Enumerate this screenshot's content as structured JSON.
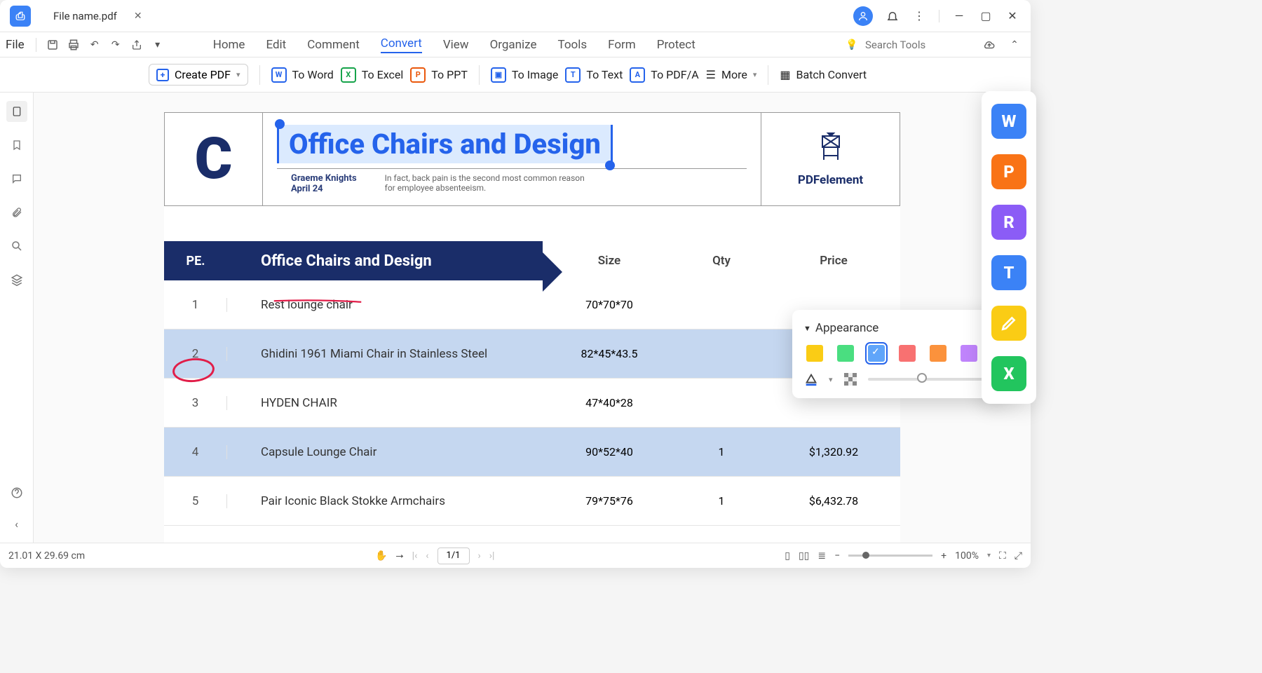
{
  "window": {
    "tab_name": "File name.pdf"
  },
  "menu": {
    "file": "File",
    "tabs": [
      "Home",
      "Edit",
      "Comment",
      "Convert",
      "View",
      "Organize",
      "Tools",
      "Form",
      "Protect"
    ],
    "active_tab": "Convert",
    "search_placeholder": "Search Tools"
  },
  "convert": {
    "create_pdf": "Create PDF",
    "to_word": "To Word",
    "to_excel": "To Excel",
    "to_ppt": "To PPT",
    "to_image": "To Image",
    "to_text": "To Text",
    "to_pdfa": "To PDF/A",
    "more": "More",
    "batch": "Batch Convert"
  },
  "document": {
    "title": "Office Chairs and Design",
    "author": "Graeme Knights",
    "date": "April 24",
    "tagline1": "In fact, back pain is the second most common reason",
    "tagline2": "for employee absenteeism.",
    "brand": "PDFelement",
    "table": {
      "pe_label": "PE.",
      "desc_label": "Office Chairs and Design",
      "headers": {
        "size": "Size",
        "qty": "Qty",
        "price": "Price"
      },
      "rows": [
        {
          "n": "1",
          "name": "Rest lounge chair",
          "size": "70*70*70",
          "qty": "",
          "price": ""
        },
        {
          "n": "2",
          "name": "Ghidini 1961 Miami Chair in Stainless Steel",
          "size": "82*45*43.5",
          "qty": "",
          "price": ""
        },
        {
          "n": "3",
          "name": "HYDEN CHAIR",
          "size": "47*40*28",
          "qty": "",
          "price": ""
        },
        {
          "n": "4",
          "name": "Capsule Lounge Chair",
          "size": "90*52*40",
          "qty": "1",
          "price": "$1,320.92"
        },
        {
          "n": "5",
          "name": "Pair Iconic Black Stokke Armchairs",
          "size": "79*75*76",
          "qty": "1",
          "price": "$6,432.78"
        }
      ]
    }
  },
  "appearance": {
    "title": "Appearance",
    "colors": [
      "#facc15",
      "#4ade80",
      "#60a5fa",
      "#f87171",
      "#fb923c",
      "#c084fc"
    ],
    "selected_index": 2
  },
  "status": {
    "dimensions": "21.01 X 29.69 cm",
    "page": "1/1",
    "zoom": "100%"
  },
  "side_tiles": [
    {
      "letter": "W",
      "color": "#3b82f6"
    },
    {
      "letter": "P",
      "color": "#f97316"
    },
    {
      "letter": "R",
      "color": "#8b5cf6"
    },
    {
      "letter": "T",
      "color": "#3b82f6"
    },
    {
      "letter": "✎",
      "color": "#facc15"
    },
    {
      "letter": "X",
      "color": "#22c55e"
    }
  ]
}
